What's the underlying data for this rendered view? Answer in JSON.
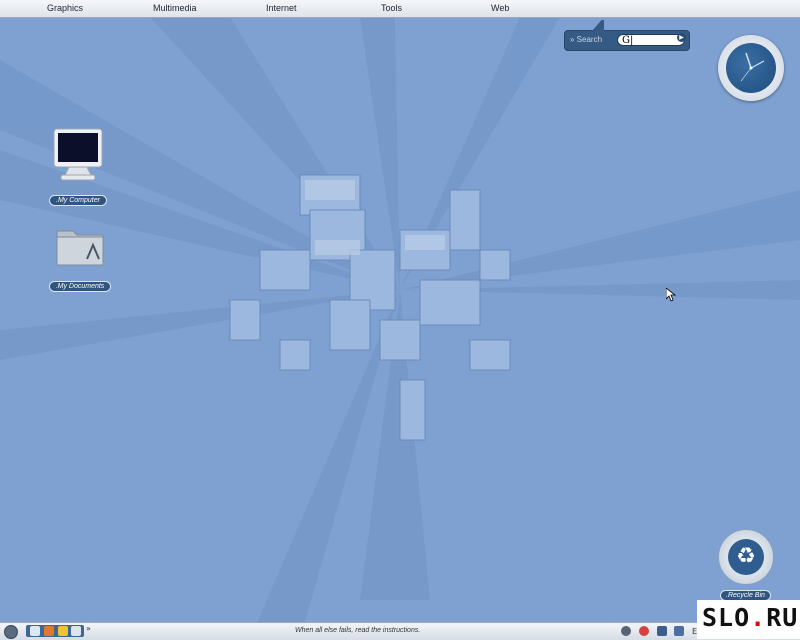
{
  "menubar": {
    "items": [
      "Graphics",
      "Multimedia",
      "Internet",
      "Tools",
      "Web"
    ]
  },
  "search": {
    "label": "Search",
    "value": "G|"
  },
  "desktop": {
    "icons": [
      {
        "label": ".My Computer",
        "icon": "monitor-icon"
      },
      {
        "label": ".My Documents",
        "icon": "folder-icon"
      }
    ],
    "recycle_label": ".Recycle Bin"
  },
  "taskbar": {
    "message": "When all else fails, read the instructions.",
    "more": "»",
    "tray_text": "E"
  },
  "watermark": {
    "text_a": "SLO",
    "dot": ".",
    "text_b": "RU"
  },
  "colors": {
    "wallpaper": "#7fa1d2",
    "widget": "#355a83"
  }
}
